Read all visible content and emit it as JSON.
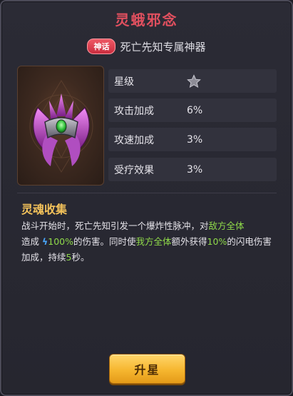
{
  "title": "灵蛾邪念",
  "rarity_badge": "神话",
  "subtitle": "死亡先知专属神器",
  "stats": [
    {
      "label": "星级",
      "value": "",
      "icon": "star-icon",
      "stars": 1
    },
    {
      "label": "攻击加成",
      "value": "6%"
    },
    {
      "label": "攻速加成",
      "value": "3%"
    },
    {
      "label": "受疗效果",
      "value": "3%"
    }
  ],
  "skill": {
    "name": "灵魂收集",
    "desc": {
      "p1": "战斗开始时，死亡先知引发一个爆炸性脉冲，对",
      "hl1": "敌方全体",
      "p2": "造成",
      "dmg": "100%",
      "p3": "的伤害。同时使",
      "hl2": "我方全体",
      "p4": "额外获得",
      "hl3": "10%",
      "p5": "的闪电伤害加成，持续",
      "hl4": "5",
      "p6": "秒。"
    }
  },
  "button": {
    "label": "升星"
  },
  "colors": {
    "title": "#e2505f",
    "highlight": "#8fd94a",
    "skill_title": "#f2c15a",
    "lightning": "#4aa8ff",
    "button": "#f6b62f"
  }
}
